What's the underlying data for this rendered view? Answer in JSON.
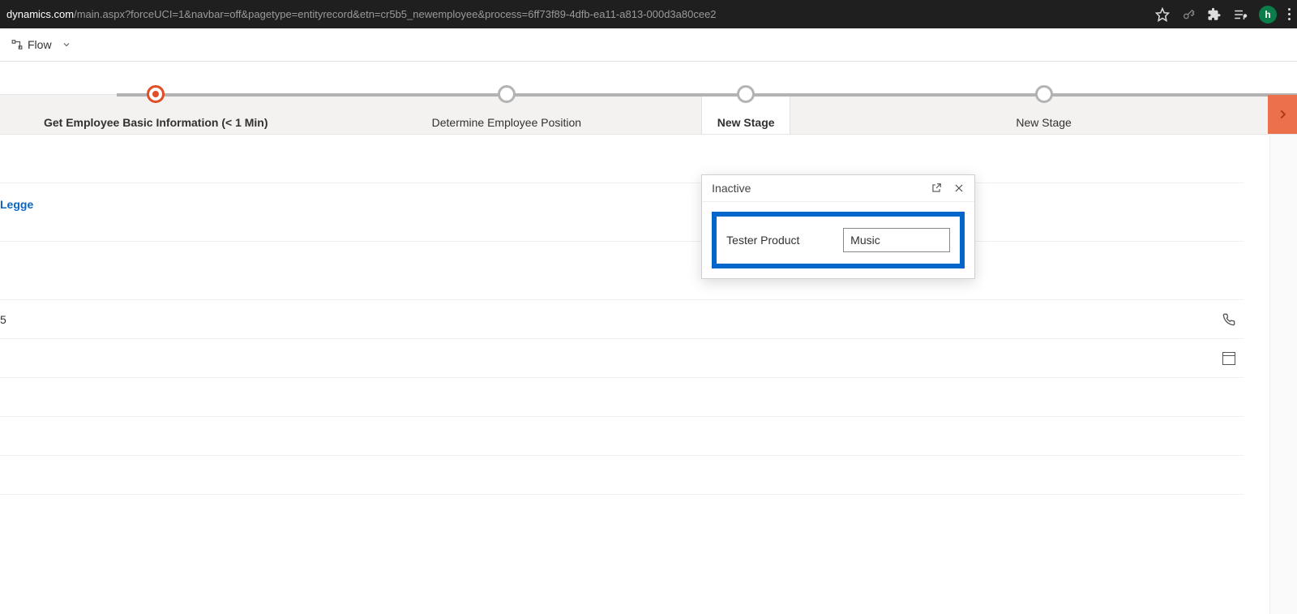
{
  "browser": {
    "url_domain": "dynamics.com",
    "url_rest": "/main.aspx?forceUCI=1&navbar=off&pagetype=entityrecord&etn=cr5b5_newemployee&process=6ff73f89-4dfb-ea11-a813-000d3a80cee2",
    "avatar_letter": "h"
  },
  "commandbar": {
    "flow_label": "Flow"
  },
  "stages": [
    {
      "label": "Get Employee Basic Information  (< 1 Min)",
      "active_dot": true
    },
    {
      "label": "Determine Employee Position",
      "active_dot": false
    },
    {
      "label": "New Stage",
      "active_dot": false,
      "is_open": true
    },
    {
      "label": "New Stage",
      "active_dot": false
    }
  ],
  "popup": {
    "status": "Inactive",
    "field_label": "Tester Product",
    "field_value": "Music"
  },
  "form": {
    "link_value": "Legge",
    "phone_value": "5"
  }
}
